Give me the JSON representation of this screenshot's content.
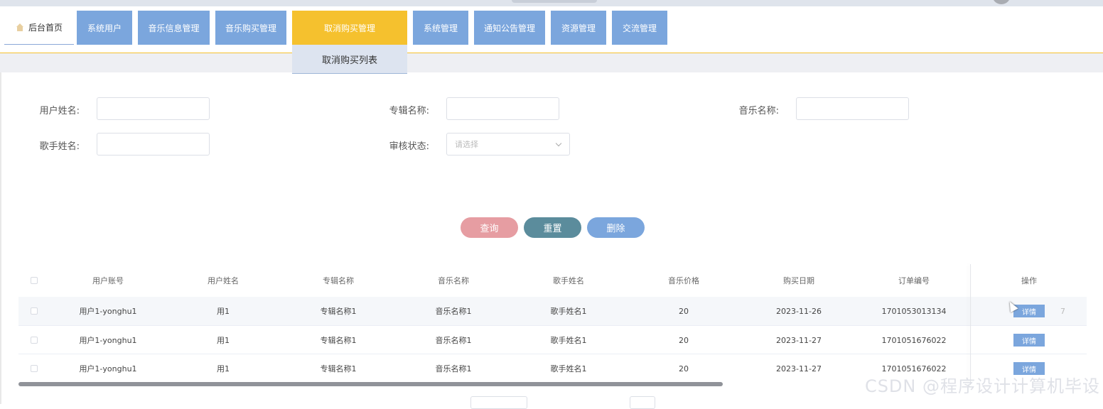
{
  "nav": {
    "home": "后台首页",
    "items": [
      "系统用户",
      "音乐信息管理",
      "音乐购买管理",
      "取消购买管理",
      "系统管理",
      "通知公告管理",
      "资源管理",
      "交流管理"
    ],
    "dropdown": "取消购买列表"
  },
  "colors": {
    "nav_bg": "#7ba6dd",
    "nav_active": "#f5c12e",
    "query": "#e69da2",
    "reset": "#5b8c9c",
    "delete": "#7ba6dd"
  },
  "form": {
    "user_name_label": "用户姓名:",
    "album_label": "专辑名称:",
    "music_label": "音乐名称:",
    "singer_label": "歌手姓名:",
    "status_label": "审核状态:",
    "status_placeholder": "请选择"
  },
  "buttons": {
    "query": "查询",
    "reset": "重置",
    "delete": "删除"
  },
  "table": {
    "headers": [
      "用户账号",
      "用户姓名",
      "专辑名称",
      "音乐名称",
      "歌手姓名",
      "音乐价格",
      "购买日期",
      "订单编号",
      "操作"
    ],
    "rows": [
      [
        "用户1-yonghu1",
        "用1",
        "专辑名称1",
        "音乐名称1",
        "歌手姓名1",
        "20",
        "2023-11-26",
        "1701053013134"
      ],
      [
        "用户1-yonghu1",
        "用1",
        "专辑名称1",
        "音乐名称1",
        "歌手姓名1",
        "20",
        "2023-11-27",
        "1701051676022"
      ],
      [
        "用户1-yonghu1",
        "用1",
        "专辑名称1",
        "音乐名称1",
        "歌手姓名1",
        "20",
        "2023-11-27",
        "1701051676022"
      ]
    ],
    "detail": "详情",
    "ghost": "7"
  },
  "watermark": "CSDN @程序设计计算机毕设"
}
